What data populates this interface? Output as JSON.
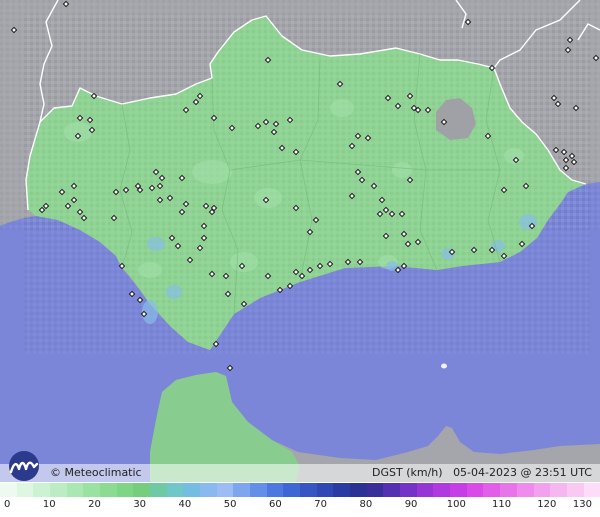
{
  "map": {
    "brand": "© Meteoclimatic",
    "variable": "DGST (km/h)",
    "timestamp": "05-04-2023 @ 23:51 UTC",
    "colors": {
      "sea": "#7b86d8",
      "land_outside": "#a4a6ab",
      "region": "#8fd494",
      "borders": "#ffffff",
      "station_marker": "#1a1a1a"
    }
  },
  "legend": {
    "labels": [
      "0",
      "10",
      "20",
      "30",
      "40",
      "50",
      "60",
      "70",
      "80",
      "90",
      "100",
      "110",
      "120",
      "130"
    ],
    "colors": [
      "#eefaf0",
      "#dff6e3",
      "#cdf1d3",
      "#bcecc3",
      "#abe7b2",
      "#9ae2a1",
      "#8bdc92",
      "#7fd586",
      "#74ce7d",
      "#6fc9a3",
      "#6fc7c7",
      "#74bde2",
      "#8ab9f0",
      "#9bbcf5",
      "#7ea6ef",
      "#648fe8",
      "#4d78df",
      "#3e66d4",
      "#3656c4",
      "#2f48b4",
      "#2a3ca4",
      "#2a3294",
      "#3a2e9a",
      "#5530b2",
      "#7433c6",
      "#9636d6",
      "#b03adf",
      "#c53ee6",
      "#d94ae8",
      "#e25ee8",
      "#e874ea",
      "#ee8bec",
      "#f2a1ee",
      "#f6b6f0",
      "#f9c9f4",
      "#fcdcf8"
    ]
  }
}
